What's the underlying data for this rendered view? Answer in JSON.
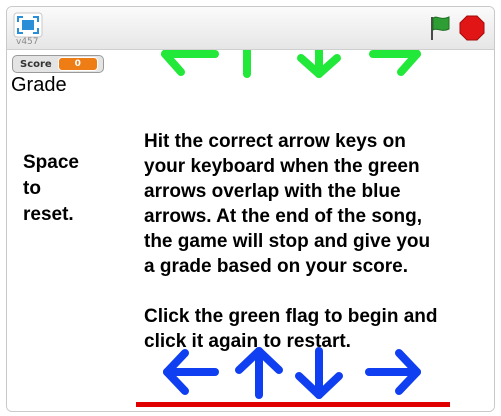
{
  "player": {
    "version": "v457"
  },
  "stage": {
    "score_monitor": {
      "label": "Score",
      "value": "0"
    },
    "grade_label": "Grade",
    "reset_hint": [
      "Space",
      "to",
      "reset."
    ],
    "instructions": {
      "lines_para1": [
        "Hit the correct arrow keys on",
        "your keyboard when the green",
        "arrows overlap with the blue",
        "arrows. At the end of the song,",
        "the game will stop and give you",
        "a grade based on your score."
      ],
      "lines_para2": [
        "Click the green flag to begin and",
        "click it again to restart."
      ]
    }
  },
  "icons": {
    "fullscreen": "fullscreen-icon",
    "green_flag": "green-flag-icon",
    "stop": "stop-sign-icon",
    "arrows": [
      "left-arrow",
      "up-arrow",
      "down-arrow",
      "right-arrow"
    ]
  },
  "colors": {
    "green_arrow": "#22e83a",
    "blue_arrow": "#0f3ff0",
    "red_line": "#e00000",
    "score_value_bg": "#ee7d16",
    "flag_green": "#2e9d33",
    "stop_red": "#e11515"
  }
}
